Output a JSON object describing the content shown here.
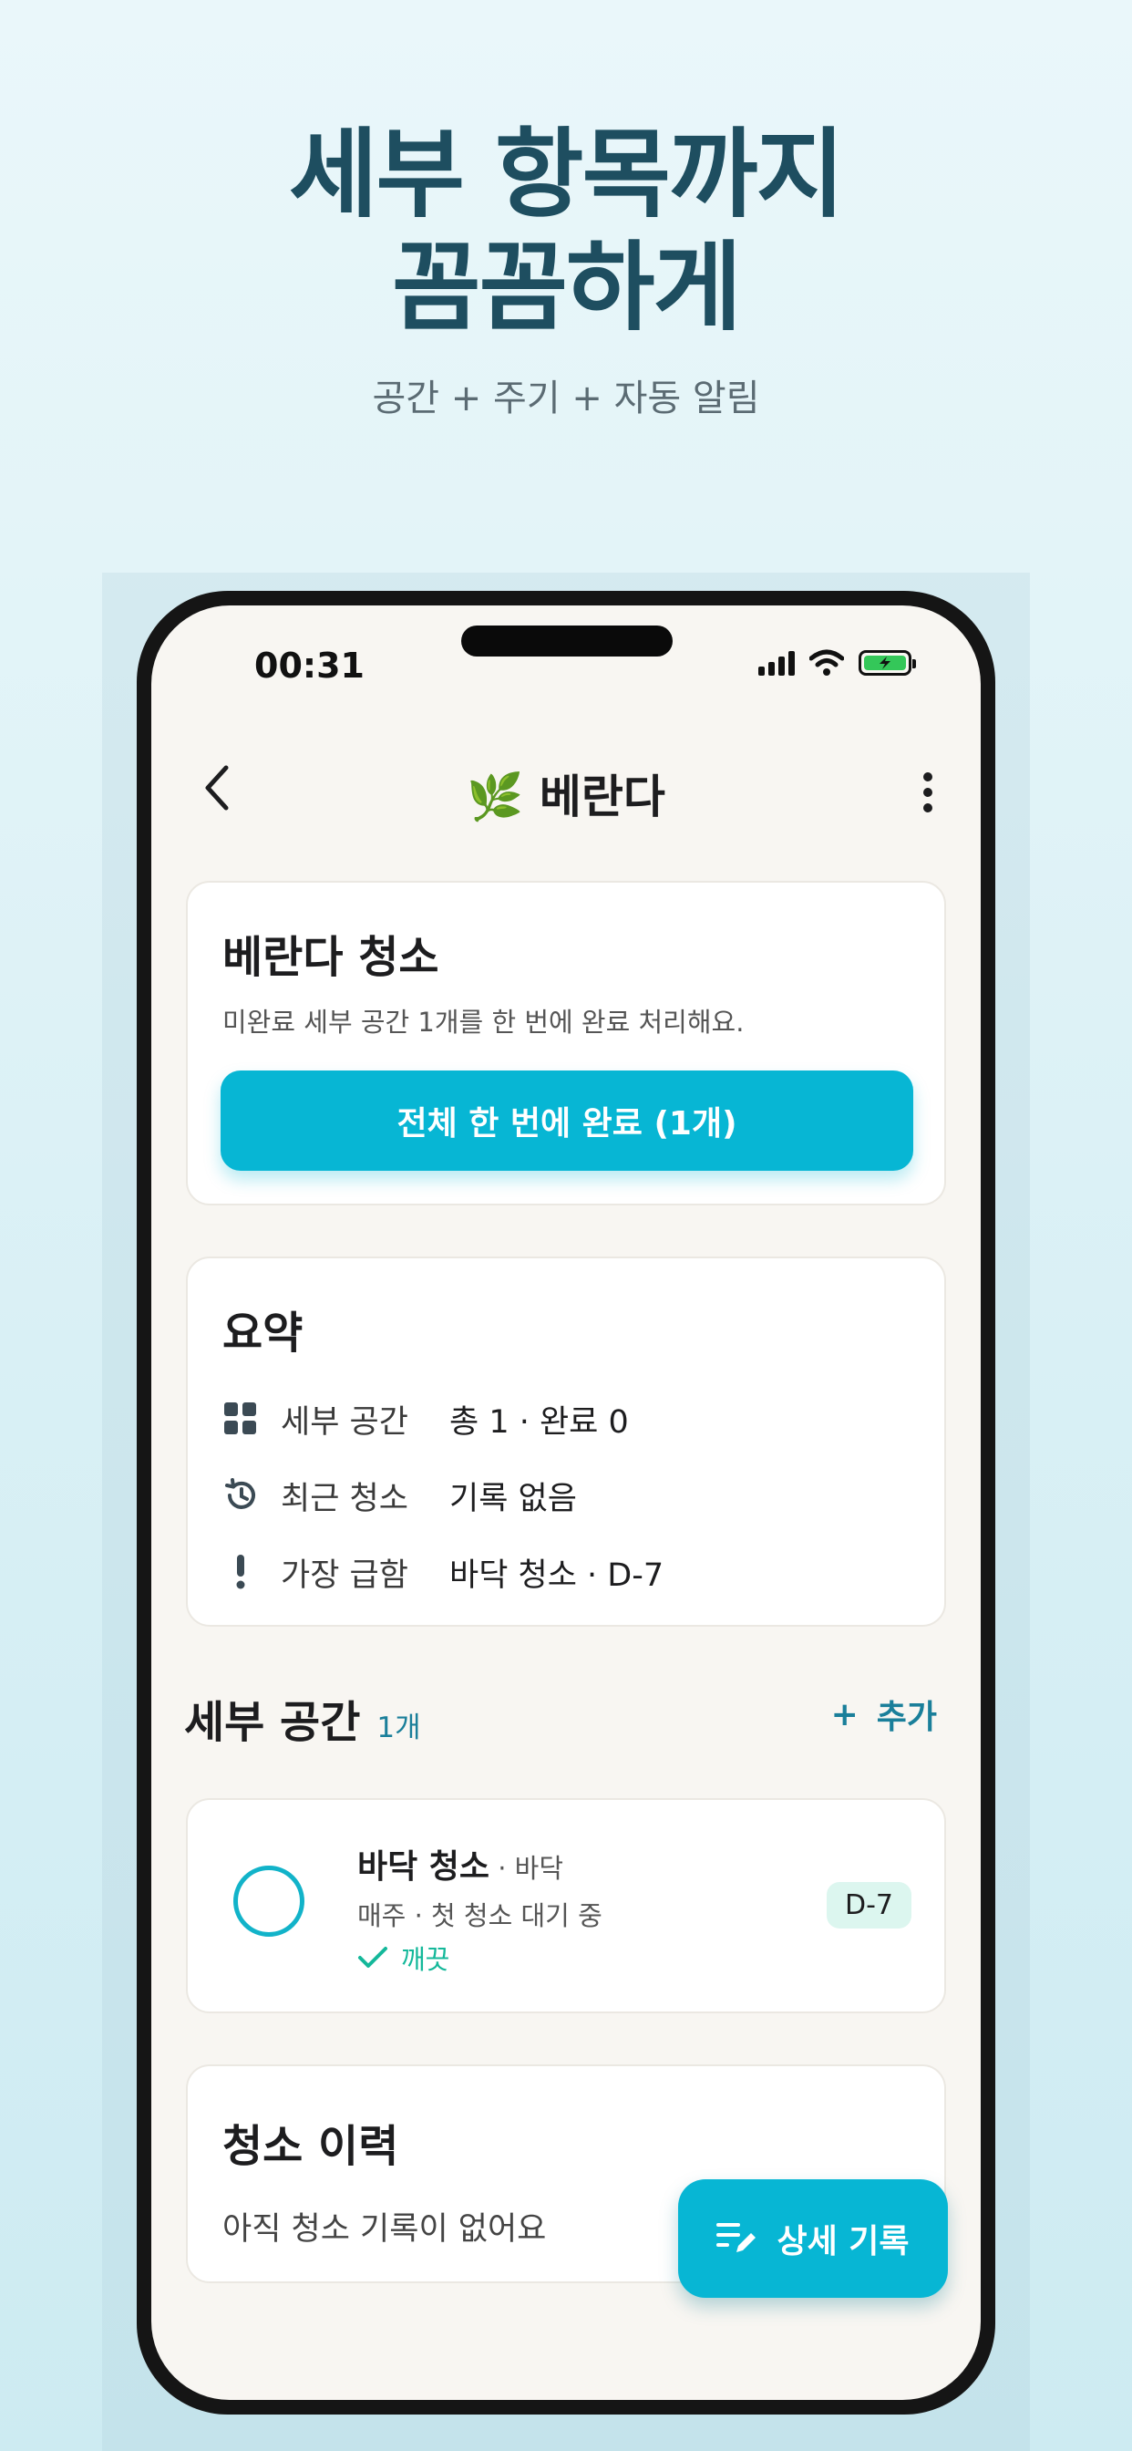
{
  "promo": {
    "title": "세부 항목까지\n꼼꼼하게",
    "subtitle": "공간 + 주기 + 자동 알림"
  },
  "status_bar": {
    "time": "00:31"
  },
  "nav": {
    "emoji": "🌿",
    "title": "베란다"
  },
  "clean_card": {
    "title": "베란다 청소",
    "description": "미완료 세부 공간 1개를 한 번에 완료 처리해요.",
    "button_label": "전체 한 번에 완료 (1개)"
  },
  "summary": {
    "title": "요약",
    "rows": [
      {
        "label": "세부 공간",
        "value": "총 1 · 완료 0",
        "icon": "grid-icon"
      },
      {
        "label": "최근 청소",
        "value": "기록 없음",
        "icon": "history-icon"
      },
      {
        "label": "가장 급함",
        "value": "바닥 청소 · D-7",
        "icon": "exclamation-icon"
      }
    ]
  },
  "subspaces": {
    "title": "세부 공간",
    "count": "1개",
    "add_icon": "+",
    "add_label": "추가",
    "items": [
      {
        "name": "바닥 청소",
        "location": " · 바닥",
        "meta": "매주 · 첫 청소 대기 중",
        "status": "깨끗",
        "dday": "D-7"
      }
    ]
  },
  "history": {
    "title": "청소 이력",
    "empty_text": "아직 청소 기록이 없어요"
  },
  "fab": {
    "label": "상세 기록"
  },
  "colors": {
    "accent": "#07b6d4",
    "title": "#1e4e60",
    "link": "#1a7f9a",
    "success": "#14b89a",
    "dday_bg": "#dcf6ef"
  }
}
